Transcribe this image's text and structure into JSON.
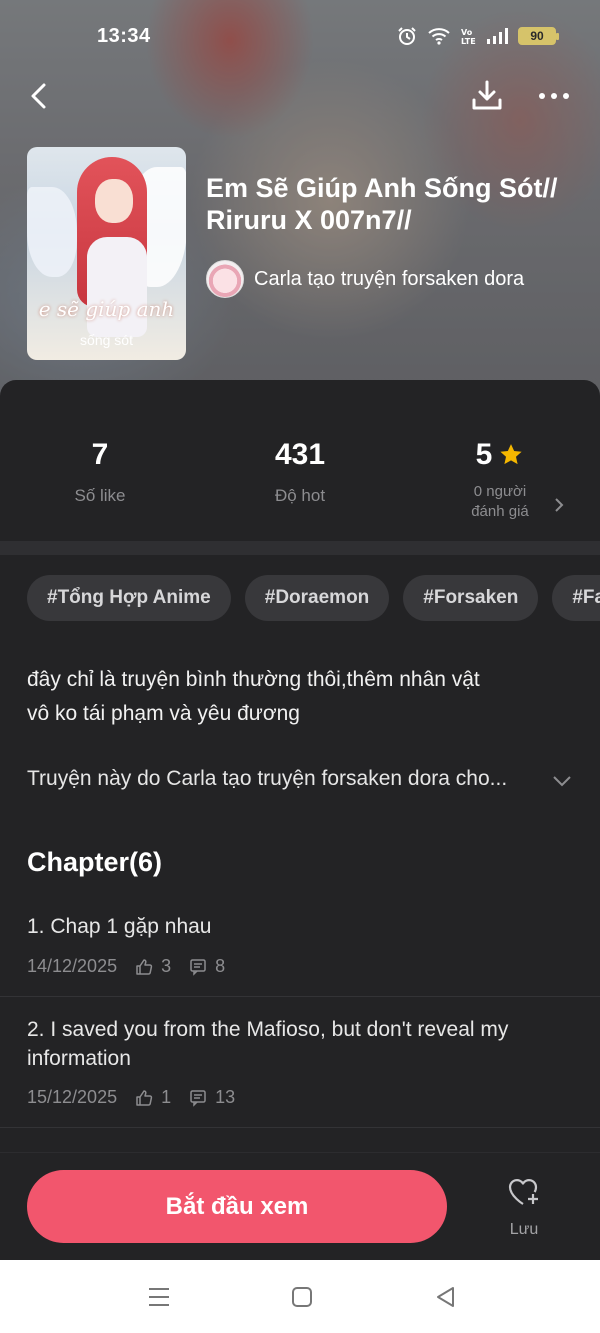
{
  "status_bar": {
    "time": "13:34",
    "battery": "90"
  },
  "header": {
    "back_icon": "chevron-left-icon",
    "download_icon": "download-icon",
    "more_icon": "more-horizontal-icon"
  },
  "book": {
    "title": "Em Sẽ Giúp Anh Sống Sót// Riruru X 007n7//",
    "cover_title": "e sẽ giúp anh",
    "cover_subtitle": "sống sót",
    "author": "Carla tạo truyện forsaken dora"
  },
  "stats": {
    "likes_value": "7",
    "likes_label": "Số like",
    "hot_value": "431",
    "hot_label": "Độ hot",
    "rating_value": "5",
    "rating_label_line1": "0 người",
    "rating_label_line2": "đánh giá",
    "star_color": "#f5b700"
  },
  "tags": [
    "#Tổng Hợp Anime",
    "#Doraemon",
    "#Forsaken",
    "#Fa"
  ],
  "description": {
    "line1": "đây chỉ là truyện bình thường thôi,thêm nhân vật",
    "line2": "vô ko tái phạm và yêu đương",
    "credit": "Truyện này do Carla tạo truyện forsaken dora cho..."
  },
  "chapters": {
    "heading": "Chapter(6)",
    "items": [
      {
        "title": "1. Chap 1 gặp nhau",
        "date": "14/12/2025",
        "likes": "3",
        "comments": "8"
      },
      {
        "title": "2. I saved you from the Mafioso, but don't reveal my information",
        "date": "15/12/2025",
        "likes": "1",
        "comments": "13"
      }
    ]
  },
  "actions": {
    "start_label": "Bắt đầu xem",
    "save_label": "Lưu",
    "accent_color": "#f2566d"
  }
}
